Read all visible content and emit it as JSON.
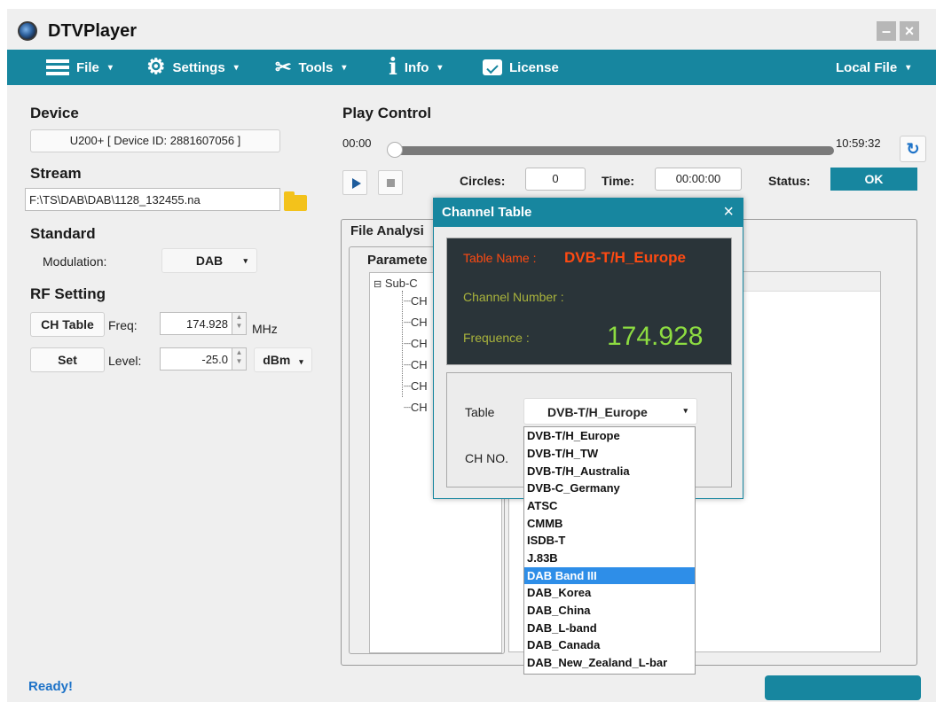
{
  "app": {
    "title": "DTVPlayer"
  },
  "menu": {
    "file": "File",
    "settings": "Settings",
    "tools": "Tools",
    "info": "Info",
    "license": "License",
    "local_file": "Local File",
    "caret": "▾"
  },
  "device": {
    "heading": "Device",
    "value": "U200+ [ Device ID: 2881607056 ]"
  },
  "stream": {
    "heading": "Stream",
    "path": "F:\\TS\\DAB\\DAB\\1128_132455.na"
  },
  "standard": {
    "heading": "Standard",
    "modulation_label": "Modulation:",
    "modulation_value": "DAB"
  },
  "rf": {
    "heading": "RF Setting",
    "ch_table_button": "CH Table",
    "freq_label": "Freq:",
    "freq_value": "174.928",
    "freq_unit": "MHz",
    "set_button": "Set",
    "level_label": "Level:",
    "level_value": "-25.0",
    "level_unit": "dBm"
  },
  "play_control": {
    "heading": "Play Control",
    "time_start": "00:00",
    "time_end": "10:59:32",
    "progress": 0.0,
    "circles_label": "Circles:",
    "circles_value": "0",
    "time_label": "Time:",
    "time_value": "00:00:00",
    "status_label": "Status:",
    "status_value": "OK"
  },
  "file_analysis": {
    "title": "File Analysi",
    "params_title": "Paramete",
    "tree_root": "Sub-C",
    "tree_children": [
      "CH",
      "CH",
      "CH",
      "CH",
      "CH",
      "CH"
    ]
  },
  "channel_table": {
    "title": "Channel Table",
    "close": "×",
    "table_name_label": "Table Name :",
    "table_name_value": "DVB-T/H_Europe",
    "channel_number_label": "Channel Number :",
    "frequence_label": "Frequence :",
    "frequence_value": "174.928",
    "table_label": "Table",
    "table_selected": "DVB-T/H_Europe",
    "ch_no_label": "CH NO.",
    "options": [
      "DVB-T/H_Europe",
      "DVB-T/H_TW",
      "DVB-T/H_Australia",
      "DVB-C_Germany",
      "ATSC",
      "CMMB",
      "ISDB-T",
      "J.83B",
      "DAB Band III",
      "DAB_Korea",
      "DAB_China",
      "DAB_L-band",
      "DAB_Canada",
      "DAB_New_Zealand_L-bar"
    ],
    "highlighted_option": "DAB Band III"
  },
  "statusbar": {
    "text": "Ready!"
  },
  "colors": {
    "accent": "#17869f",
    "display_bg": "#2a3439",
    "highlight": "#2e8ee8"
  }
}
